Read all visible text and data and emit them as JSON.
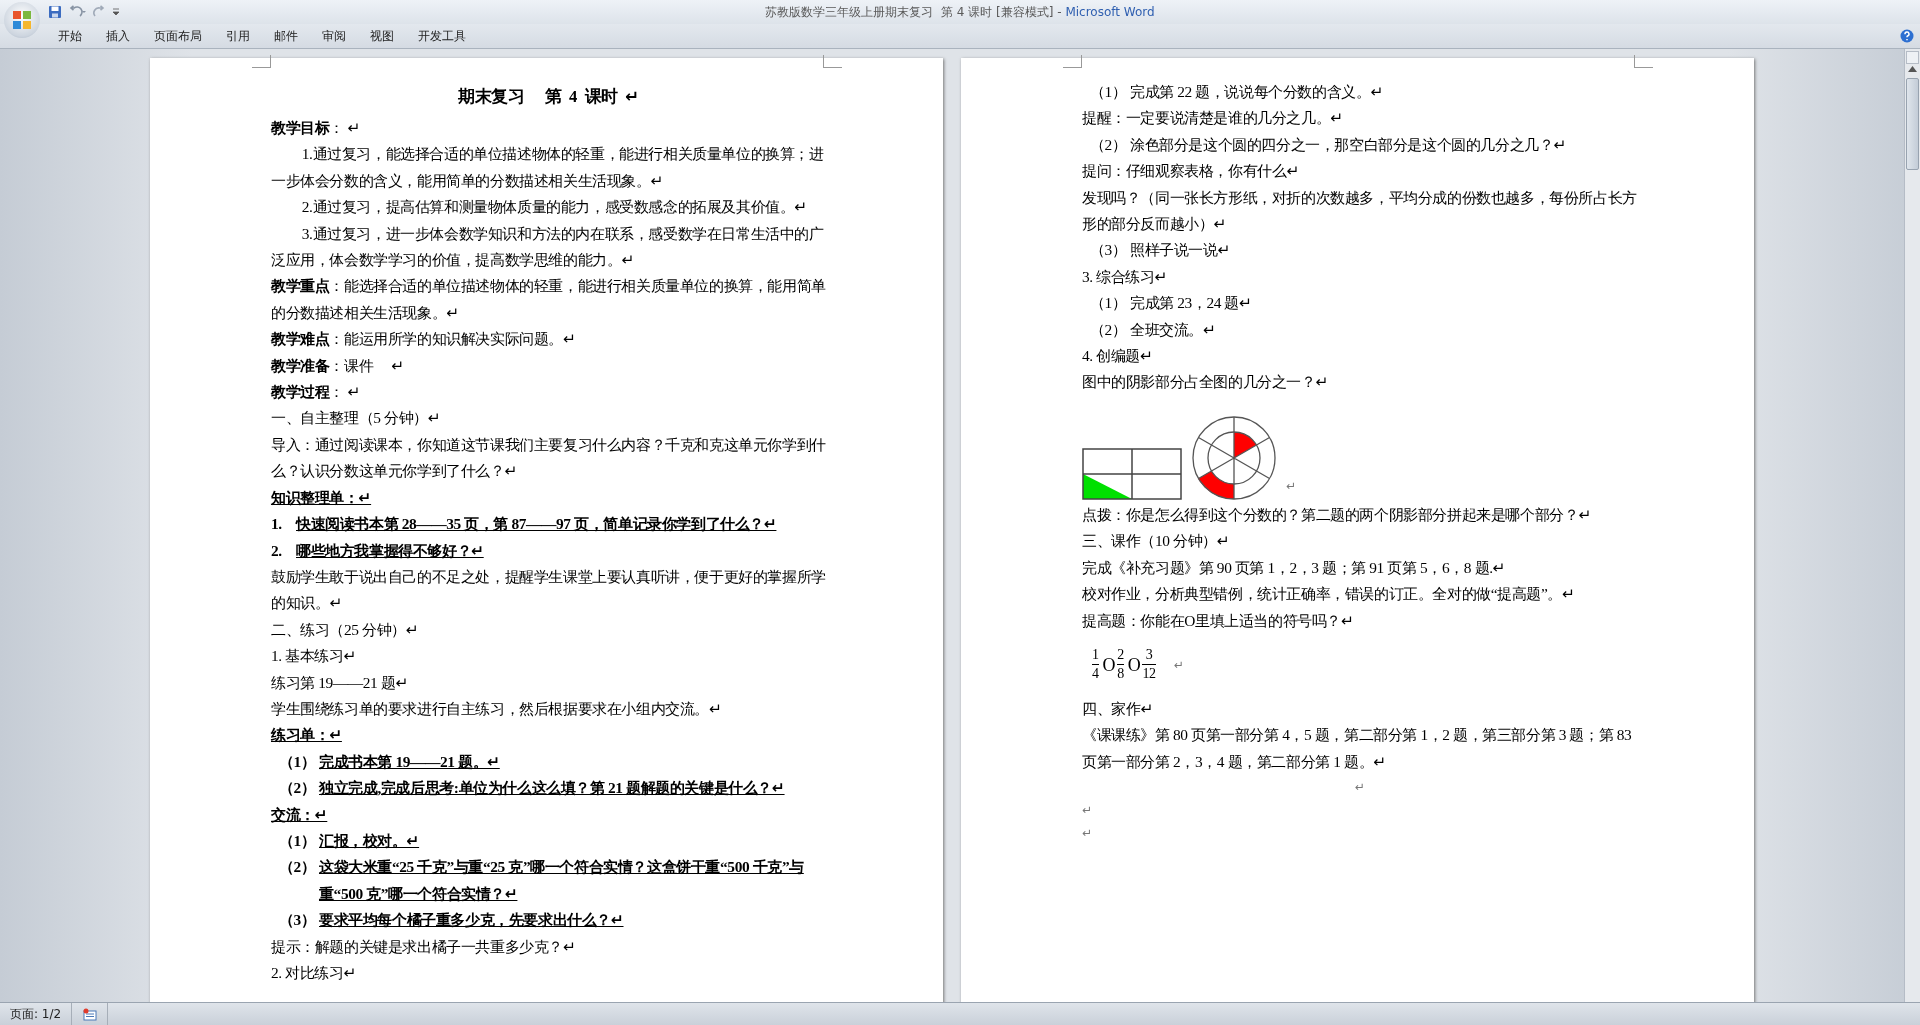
{
  "window": {
    "title": "苏教版数学三年级上册期末复习  第 4 课时 [兼容模式] - ",
    "app": "Microsoft Word"
  },
  "ribbon_tabs": [
    {
      "label": "开始"
    },
    {
      "label": "插入"
    },
    {
      "label": "页面布局"
    },
    {
      "label": "引用"
    },
    {
      "label": "邮件"
    },
    {
      "label": "审阅"
    },
    {
      "label": "视图"
    },
    {
      "label": "开发工具"
    }
  ],
  "pages": [
    {
      "blocks": [
        {
          "kind": "heading",
          "text": "期末复习　 第  4  课时  ↵"
        },
        {
          "kind": "para",
          "text": "**教学目标**： ↵"
        },
        {
          "kind": "para",
          "indent": true,
          "text": "1.通过复习，能选择合适的单位描述物体的轻重，能进行相关质量单位的换算；进一步体会分数的含义，能用简单的分数描述相关生活现象。↵"
        },
        {
          "kind": "para",
          "indent": true,
          "text": "2.通过复习，提高估算和测量物体质量的能力，感受数感念的拓展及其价值。↵"
        },
        {
          "kind": "para",
          "indent": true,
          "text": "3.通过复习，进一步体会数学知识和方法的内在联系，感受数学在日常生活中的广泛应用，体会数学学习的价值，提高数学思维的能力。↵"
        },
        {
          "kind": "para",
          "text": "**教学重点**：能选择合适的单位描述物体的轻重，能进行相关质量单位的换算，能用简单的分数描述相关生活现象。↵"
        },
        {
          "kind": "para",
          "text": "**教学难点**：能运用所学的知识解决实际问题。↵"
        },
        {
          "kind": "para",
          "text": "**教学准备**：课件　 ↵"
        },
        {
          "kind": "para",
          "text": "**教学过程**： ↵"
        },
        {
          "kind": "para",
          "text": "一、自主整理（5 分钟）↵"
        },
        {
          "kind": "para",
          "text": "导入：通过阅读课本，你知道这节课我们主要复习什么内容？千克和克这单元你学到什么？认识分数这单元你学到了什么？↵"
        },
        {
          "kind": "para",
          "emphasis": true,
          "text": "知识整理单：↵"
        },
        {
          "kind": "numbered",
          "number": "1.",
          "emphasis": true,
          "text": "快速阅读书本第 28——35 页，第 87——97 页，简单记录你学到了什么？↵"
        },
        {
          "kind": "numbered",
          "number": "2.",
          "emphasis": true,
          "text": "哪些地方我掌握得不够好？↵"
        },
        {
          "kind": "para",
          "text": "鼓励学生敢于说出自己的不足之处，提醒学生课堂上要认真听讲，便于更好的掌握所学的知识。↵"
        },
        {
          "kind": "para",
          "text": "二、练习（25 分钟）↵"
        },
        {
          "kind": "para",
          "text": "1.  基本练习↵"
        },
        {
          "kind": "para",
          "text": "练习第 19——21 题↵"
        },
        {
          "kind": "para",
          "text": "学生围绕练习单的要求进行自主练习，然后根据要求在小组内交流。↵"
        },
        {
          "kind": "para",
          "emphasis": true,
          "text": "练习单：↵"
        },
        {
          "kind": "item",
          "number": "（1）",
          "emphasis": true,
          "text": "完成书本第 19——21 题。↵"
        },
        {
          "kind": "item",
          "number": "（2）",
          "emphasis": true,
          "text": "独立完成,完成后思考:单位为什么这么填？第 21 题解题的关键是什么？↵"
        },
        {
          "kind": "para",
          "emphasis": true,
          "text": "交流：↵"
        },
        {
          "kind": "item",
          "number": "（1）",
          "emphasis": true,
          "text": "汇报，校对。↵"
        },
        {
          "kind": "item",
          "number": "（2）",
          "emphasis": true,
          "text": "这袋大米重“25 千克”与重“25 克”哪一个符合实情？这盒饼干重“500 千克”与重“500 克”哪一个符合实情？↵"
        },
        {
          "kind": "item",
          "number": "（3）",
          "emphasis": true,
          "text": "要求平均每个橘子重多少克，先要求出什么？↵"
        },
        {
          "kind": "para",
          "text": "提示：解题的关键是求出橘子一共重多少克？↵"
        },
        {
          "kind": "para",
          "text": "2.  对比练习↵"
        }
      ]
    },
    {
      "blocks": [
        {
          "kind": "item",
          "number": "（1）",
          "text": "完成第 22 题，说说每个分数的含义。↵"
        },
        {
          "kind": "para",
          "text": "提醒：一定要说清楚是谁的几分之几。↵"
        },
        {
          "kind": "item",
          "number": "（2）",
          "text": "涂色部分是这个圆的四分之一，那空白部分是这个圆的几分之几？↵"
        },
        {
          "kind": "para",
          "text": "提问：仔细观察表格，你有什么↵"
        },
        {
          "kind": "para",
          "text": "发现吗？（同一张长方形纸，对折的次数越多，平均分成的份数也越多，每份所占长方形的部分反而越小）↵"
        },
        {
          "kind": "item",
          "number": "（3）",
          "text": "照样子说一说↵"
        },
        {
          "kind": "para",
          "text": "3.  综合练习↵"
        },
        {
          "kind": "item",
          "number": "（1）",
          "text": "完成第 23，24 题↵"
        },
        {
          "kind": "item",
          "number": "（2）",
          "text": "全班交流。↵"
        },
        {
          "kind": "para",
          "text": "4.  创编题↵"
        },
        {
          "kind": "para",
          "text": "图中的阴影部分占全图的几分之一？↵"
        },
        {
          "kind": "figure",
          "text": "↵"
        },
        {
          "kind": "para",
          "text": "点拨：你是怎么得到这个分数的？第二题的两个阴影部分拼起来是哪个部分？↵"
        },
        {
          "kind": "para",
          "text": "三、课作（10 分钟）↵"
        },
        {
          "kind": "para",
          "text": "完成《补充习题》第 90 页第 1，2，3 题；第 91 页第 5，6，8 题.↵"
        },
        {
          "kind": "para",
          "text": "校对作业，分析典型错例，统计正确率，错误的订正。全对的做“提高题”。↵"
        },
        {
          "kind": "para",
          "text": "提高题：你能在O里填上适当的符号吗？↵"
        },
        {
          "kind": "fractions",
          "text": "↵",
          "parts": [
            {
              "num": "1",
              "den": "4"
            },
            {
              "symbol": "O",
              "num": "2",
              "den": "8"
            },
            {
              "symbol": "O",
              "num": "3",
              "den": "12"
            }
          ]
        },
        {
          "kind": "para",
          "text": "四、家作↵"
        },
        {
          "kind": "para",
          "text": "《课课练》第 80 页第一部分第 4，5 题，第二部分第 1，2 题，第三部分第 3 题；第 83 页第一部分第 2，3，4 题，第二部分第 1 题。↵"
        },
        {
          "kind": "empty",
          "centered": true,
          "text": "↵"
        },
        {
          "kind": "empty",
          "centered": false,
          "text": "↵"
        },
        {
          "kind": "empty",
          "centered": false,
          "text": "↵"
        }
      ]
    }
  ],
  "status_bar": {
    "page": "页面: 1/2"
  }
}
